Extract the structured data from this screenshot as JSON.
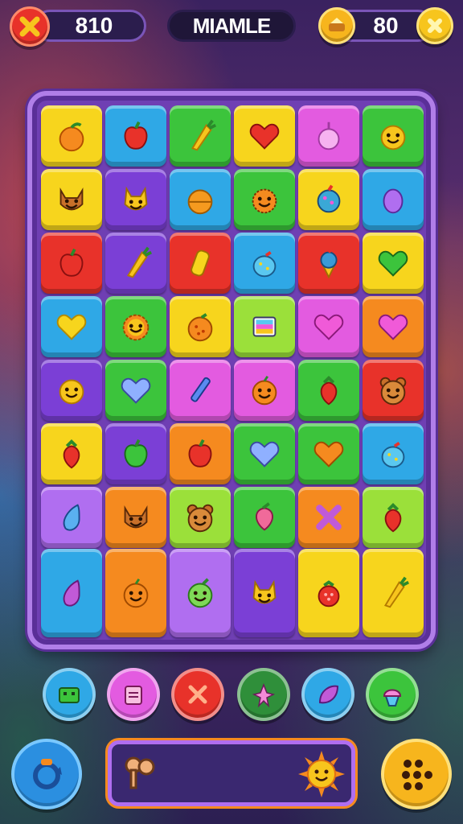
{
  "hud": {
    "score": "810",
    "title": "MIAMLE",
    "coins": "80"
  },
  "colors": {
    "yellow": "#f7d51d",
    "red": "#e8322a",
    "green": "#3cc43c",
    "blue": "#2fa8e6",
    "purple": "#7b3fd6",
    "magenta": "#e35be0",
    "orange": "#f58a1f",
    "lime": "#9be03a",
    "violet": "#b06ef0"
  },
  "board": {
    "rows": [
      [
        {
          "c": "yellow",
          "i": "peach"
        },
        {
          "c": "blue",
          "i": "apple"
        },
        {
          "c": "green",
          "i": "carrot"
        },
        {
          "c": "yellow",
          "i": "heart"
        },
        {
          "c": "magenta",
          "i": "onion"
        },
        {
          "c": "green",
          "i": "face"
        }
      ],
      [
        {
          "c": "yellow",
          "i": "fox"
        },
        {
          "c": "purple",
          "i": "cat"
        },
        {
          "c": "blue",
          "i": "orange"
        },
        {
          "c": "green",
          "i": "monster"
        },
        {
          "c": "yellow",
          "i": "berry"
        },
        {
          "c": "blue",
          "i": "egg"
        }
      ],
      [
        {
          "c": "red",
          "i": "apple"
        },
        {
          "c": "purple",
          "i": "carrot"
        },
        {
          "c": "red",
          "i": "bar"
        },
        {
          "c": "blue",
          "i": "jar"
        },
        {
          "c": "red",
          "i": "icecream"
        },
        {
          "c": "yellow",
          "i": "heart-green"
        }
      ],
      [
        {
          "c": "blue",
          "i": "heart-yellow"
        },
        {
          "c": "green",
          "i": "sun"
        },
        {
          "c": "yellow",
          "i": "orange-dots"
        },
        {
          "c": "lime",
          "i": "box"
        },
        {
          "c": "magenta",
          "i": "heart-pink"
        },
        {
          "c": "orange",
          "i": "heart-pink"
        }
      ],
      [
        {
          "c": "purple",
          "i": "face"
        },
        {
          "c": "green",
          "i": "heart-blue"
        },
        {
          "c": "magenta",
          "i": "pencil"
        },
        {
          "c": "magenta",
          "i": "face-orange"
        },
        {
          "c": "green",
          "i": "strawberry"
        },
        {
          "c": "red",
          "i": "bear"
        }
      ],
      [
        {
          "c": "yellow",
          "i": "strawberry"
        },
        {
          "c": "purple",
          "i": "apple-green"
        },
        {
          "c": "orange",
          "i": "apple"
        },
        {
          "c": "green",
          "i": "heart-blue"
        },
        {
          "c": "green",
          "i": "heart-orange"
        },
        {
          "c": "blue",
          "i": "jar"
        }
      ],
      [
        {
          "c": "violet",
          "i": "drop-blue"
        },
        {
          "c": "orange",
          "i": "fox"
        },
        {
          "c": "lime",
          "i": "bear"
        },
        {
          "c": "green",
          "i": "berry-pink"
        },
        {
          "c": "orange",
          "i": "x"
        },
        {
          "c": "lime",
          "i": "strawberry"
        }
      ],
      [
        {
          "c": "blue",
          "i": "drop-purple"
        },
        {
          "c": "orange",
          "i": "face-orange"
        },
        {
          "c": "violet",
          "i": "face-green"
        },
        {
          "c": "purple",
          "i": "cat"
        },
        {
          "c": "yellow",
          "i": "raspberry"
        },
        {
          "c": "yellow",
          "i": "carrot"
        }
      ]
    ]
  },
  "boosters": [
    {
      "name": "robot",
      "color": "#2fa8e6"
    },
    {
      "name": "calendar",
      "color": "#e35be0"
    },
    {
      "name": "x",
      "color": "#e8322a"
    },
    {
      "name": "star",
      "color": "#2f8f3a"
    },
    {
      "name": "leaf",
      "color": "#2fa8e6"
    },
    {
      "name": "cupcake",
      "color": "#3cc43c"
    }
  ]
}
